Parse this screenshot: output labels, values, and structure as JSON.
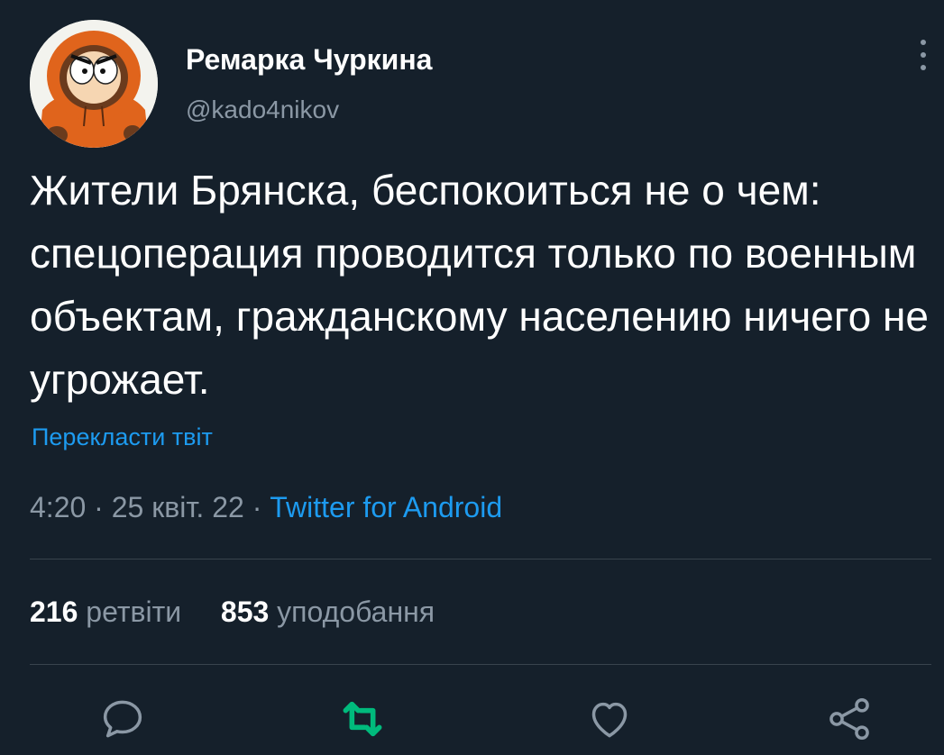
{
  "author": {
    "name": "Ремарка Чуркина",
    "handle": "@kado4nikov"
  },
  "tweet": {
    "text": "Жители Брянска, беспокоиться не о чем: спецоперация проводится только по военным объектам, гражданскому населению ничего не угрожает.",
    "translate_link": "Перекласти твіт",
    "time": "4:20",
    "date": "25 квіт. 22",
    "separator": "·",
    "source": "Twitter for Android"
  },
  "stats": {
    "retweets_count": "216",
    "retweets_label": "ретвіти",
    "likes_count": "853",
    "likes_label": "уподобання"
  },
  "actions": [
    {
      "icon": "reply-icon"
    },
    {
      "icon": "retweet-icon",
      "color": "#00ba7c"
    },
    {
      "icon": "like-icon"
    },
    {
      "icon": "share-icon"
    }
  ],
  "colors": {
    "background": "#15202b",
    "accent": "#1d9bf0",
    "muted": "#8b98a5",
    "retweeted": "#00ba7c"
  }
}
